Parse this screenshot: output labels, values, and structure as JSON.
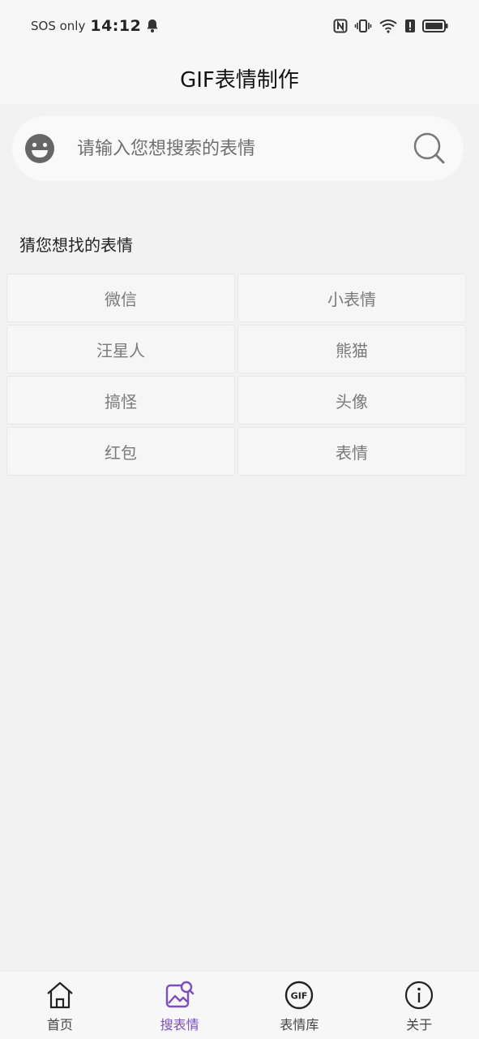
{
  "status": {
    "carrier": "SOS only",
    "time": "14:12"
  },
  "app": {
    "title": "GIF表情制作"
  },
  "search": {
    "placeholder": "请输入您想搜索的表情"
  },
  "suggestions": {
    "title": "猜您想找的表情",
    "items": [
      "微信",
      "小表情",
      "汪星人",
      "熊猫",
      "搞怪",
      "头像",
      "红包",
      "表情"
    ]
  },
  "nav": {
    "items": [
      {
        "label": "首页",
        "icon": "home-icon"
      },
      {
        "label": "搜表情",
        "icon": "image-search-icon"
      },
      {
        "label": "表情库",
        "icon": "gif-icon"
      },
      {
        "label": "关于",
        "icon": "info-icon"
      }
    ],
    "active_color": "#7b4fc2"
  }
}
